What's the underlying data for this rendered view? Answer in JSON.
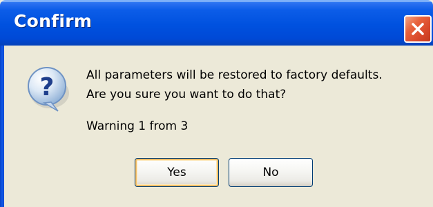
{
  "window": {
    "title": "Confirm"
  },
  "message": {
    "line1": "All parameters will be restored to factory defaults.",
    "line2": "Are you sure you want to do that?",
    "warning": "Warning 1 from 3"
  },
  "buttons": {
    "yes_label": "Yes",
    "no_label": "No"
  },
  "icons": {
    "close": "close-icon",
    "question": "question-icon"
  },
  "colors": {
    "titlebar": "#0054e3",
    "close_button": "#e0553a",
    "dialog_background": "#ece9d8",
    "default_button_highlight": "#f9c36a"
  }
}
